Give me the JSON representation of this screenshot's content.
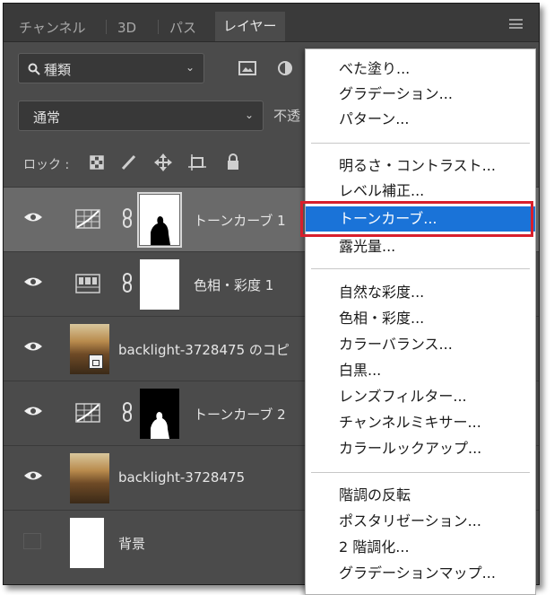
{
  "tabs": [
    "チャンネル",
    "3D",
    "パス",
    "レイヤー"
  ],
  "active_tab_index": 3,
  "filter": {
    "label": "種類"
  },
  "blend_mode": {
    "value": "通常",
    "opacity_label": "不透"
  },
  "lock": {
    "label": "ロック :"
  },
  "layers": [
    {
      "name": "トーンカーブ 1",
      "type": "curves-adjustment",
      "visible": true,
      "selected": true
    },
    {
      "name": "色相・彩度 1",
      "type": "hue-saturation-adjustment",
      "visible": true,
      "selected": false
    },
    {
      "name": "backlight-3728475 のコピ",
      "type": "smart-object",
      "visible": true,
      "selected": false
    },
    {
      "name": "トーンカーブ 2",
      "type": "curves-adjustment",
      "visible": true,
      "selected": false
    },
    {
      "name": "backlight-3728475",
      "type": "image",
      "visible": true,
      "selected": false
    },
    {
      "name": "背景",
      "type": "background",
      "visible": false,
      "selected": false
    }
  ],
  "menu": {
    "groups": [
      [
        "べた塗り...",
        "グラデーション...",
        "パターン..."
      ],
      [
        "明るさ・コントラスト...",
        "レベル補正...",
        "トーンカーブ...",
        "露光量..."
      ],
      [
        "自然な彩度...",
        "色相・彩度...",
        "カラーバランス...",
        "白黒...",
        "レンズフィルター...",
        "チャンネルミキサー...",
        "カラールックアップ..."
      ],
      [
        "階調の反転",
        "ポスタリゼーション...",
        "2 階調化...",
        "グラデーションマップ..."
      ]
    ],
    "highlighted": "トーンカーブ..."
  },
  "colors": {
    "panel": "#4b4b4b",
    "highlight": "#1a73d8",
    "callout": "#d81f2c"
  }
}
